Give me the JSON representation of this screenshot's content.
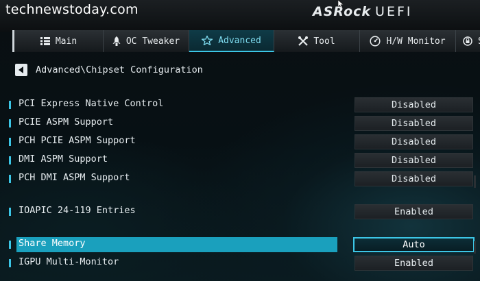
{
  "watermark": "technewstoday.com",
  "brand": {
    "name": "ASRock",
    "product": "UEFI"
  },
  "tabs": [
    {
      "label": "Main",
      "icon": "list-icon",
      "active": false
    },
    {
      "label": "OC Tweaker",
      "icon": "rocket-icon",
      "active": false
    },
    {
      "label": "Advanced",
      "icon": "star-icon",
      "active": true
    },
    {
      "label": "Tool",
      "icon": "tools-icon",
      "active": false
    },
    {
      "label": "H/W Monitor",
      "icon": "monitor-gauge-icon",
      "active": false
    },
    {
      "label": "S",
      "icon": "security-icon",
      "active": false
    }
  ],
  "breadcrumb": "Advanced\\Chipset Configuration",
  "settings": [
    {
      "label": "PCI Express Native Control",
      "value": "Disabled"
    },
    {
      "label": "PCIE ASPM Support",
      "value": "Disabled"
    },
    {
      "label": "PCH PCIE ASPM Support",
      "value": "Disabled"
    },
    {
      "label": "DMI ASPM Support",
      "value": "Disabled"
    },
    {
      "label": "PCH DMI ASPM Support",
      "value": "Disabled"
    },
    {
      "label": "IOAPIC 24-119 Entries",
      "value": "Enabled"
    },
    {
      "label": "Share Memory",
      "value": "Auto",
      "selected": true
    },
    {
      "label": "IGPU Multi-Monitor",
      "value": "Enabled"
    }
  ],
  "colors": {
    "accent": "#3cc6e6",
    "selected_row": "#1aa0bd",
    "background": "#05090c"
  }
}
